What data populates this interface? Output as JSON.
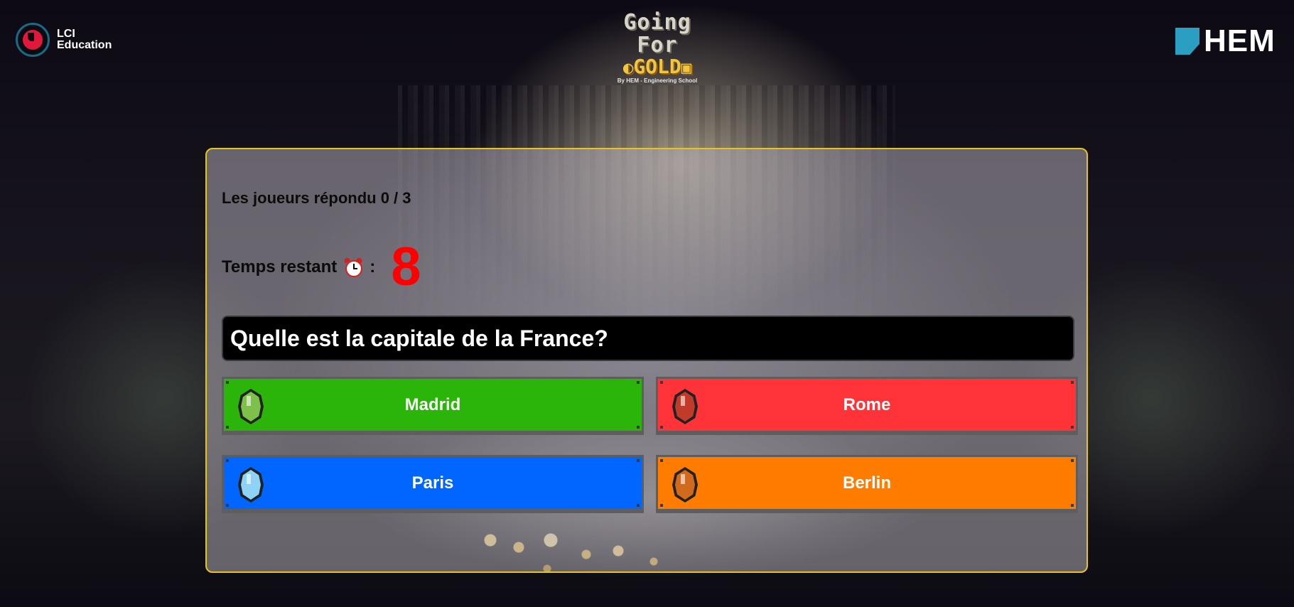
{
  "header": {
    "left_logo": {
      "line1": "LCI",
      "line2": "Education"
    },
    "center_logo": {
      "top": "Going For",
      "gold": "GOLD",
      "subtitle": "By HEM - Engineering School"
    },
    "right_logo": {
      "text": "HEM"
    }
  },
  "game": {
    "players_answered": "Les joueurs répondu 0 / 3",
    "timer_label": "Temps restant",
    "timer_colon": ":",
    "timer_value": "8",
    "question": "Quelle est la capitale de la France?",
    "answers": [
      {
        "label": "Madrid",
        "color": "#2bb50a",
        "gem_color": "#7ec14a",
        "gem_icon": "green-gem-icon"
      },
      {
        "label": "Rome",
        "color": "#ff3338",
        "gem_color": "#c23a2a",
        "gem_icon": "red-gem-icon"
      },
      {
        "label": "Paris",
        "color": "#0066ff",
        "gem_color": "#8ed3f5",
        "gem_icon": "blue-gem-icon"
      },
      {
        "label": "Berlin",
        "color": "#ff7c00",
        "gem_color": "#d06a1c",
        "gem_icon": "orange-gem-icon"
      }
    ]
  },
  "colors": {
    "panel_border": "#e9c417",
    "timer": "#ff0000",
    "question_bg": "#000000"
  }
}
